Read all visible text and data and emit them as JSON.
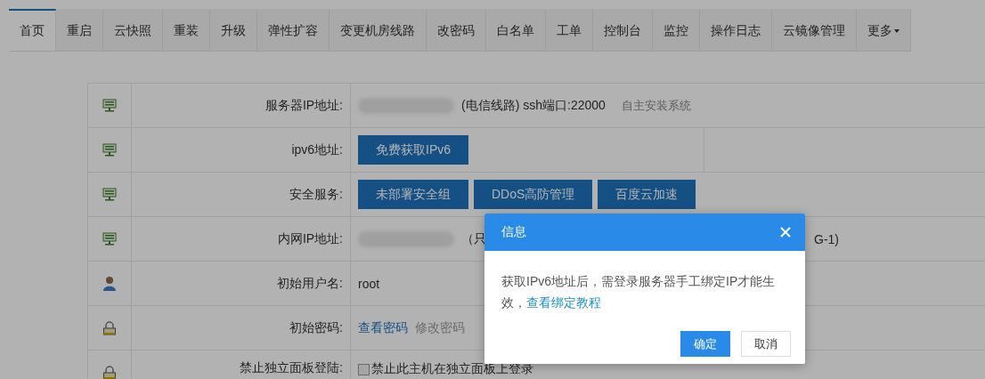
{
  "tabs": [
    {
      "label": "首页",
      "selected": true,
      "kind": "tab"
    },
    {
      "label": "重启",
      "selected": false,
      "kind": "tab"
    },
    {
      "label": "云快照",
      "selected": false,
      "kind": "tab"
    },
    {
      "label": "重装",
      "selected": false,
      "kind": "tab"
    },
    {
      "label": "升级",
      "selected": false,
      "kind": "tab"
    },
    {
      "label": "弹性扩容",
      "selected": false,
      "kind": "tab"
    },
    {
      "label": "变更机房线路",
      "selected": false,
      "kind": "tab"
    },
    {
      "label": "改密码",
      "selected": false,
      "kind": "tab"
    },
    {
      "label": "白名单",
      "selected": false,
      "kind": "tab"
    },
    {
      "label": "工单",
      "selected": false,
      "kind": "tab"
    },
    {
      "label": "控制台",
      "selected": false,
      "kind": "tab"
    },
    {
      "label": "监控",
      "selected": false,
      "kind": "tab"
    },
    {
      "label": "操作日志",
      "selected": false,
      "kind": "tab"
    },
    {
      "label": "云镜像管理",
      "selected": false,
      "kind": "tab"
    },
    {
      "label": "更多",
      "selected": false,
      "kind": "menu"
    }
  ],
  "info_rows": [
    {
      "kind": "monitor",
      "label": "服务器IP地址:",
      "value": {
        "kind": "ip",
        "masked": true,
        "text": "(电信线路) ssh端口:22000",
        "note": "自主安装系统"
      }
    },
    {
      "kind": "monitor",
      "label": "ipv6地址:",
      "value": {
        "kind": "buttons",
        "split": true,
        "buttons": [
          "免费获取IPv6"
        ]
      }
    },
    {
      "kind": "monitor",
      "label": "安全服务:",
      "value": {
        "kind": "buttons",
        "split": false,
        "buttons": [
          "未部署安全组",
          "DDoS高防管理",
          "百度云加速"
        ]
      }
    },
    {
      "kind": "monitor",
      "label": "内网IP地址:",
      "value": {
        "kind": "ip",
        "masked": true,
        "text": "（只",
        "tail": "G-1)"
      }
    },
    {
      "kind": "user",
      "label": "初始用户名:",
      "value": {
        "kind": "text",
        "text": "root"
      }
    },
    {
      "kind": "lock",
      "label": "初始密码:",
      "value": {
        "kind": "links",
        "links": [
          {
            "label": "查看密码",
            "muted": false
          },
          {
            "label": "修改密码",
            "muted": true
          }
        ]
      }
    },
    {
      "kind": "lock",
      "label": "禁止独立面板登陆:",
      "value": {
        "kind": "checkbox",
        "checked": false,
        "text": "禁止此主机在独立面板上登录"
      }
    }
  ],
  "dialog": {
    "title": "信息",
    "message": "获取IPv6地址后，需登录服务器手工绑定IP才能生效，",
    "link": "查看绑定教程",
    "buttons": [
      {
        "label": "确定",
        "primary": true
      },
      {
        "label": "取消",
        "primary": false
      }
    ]
  }
}
